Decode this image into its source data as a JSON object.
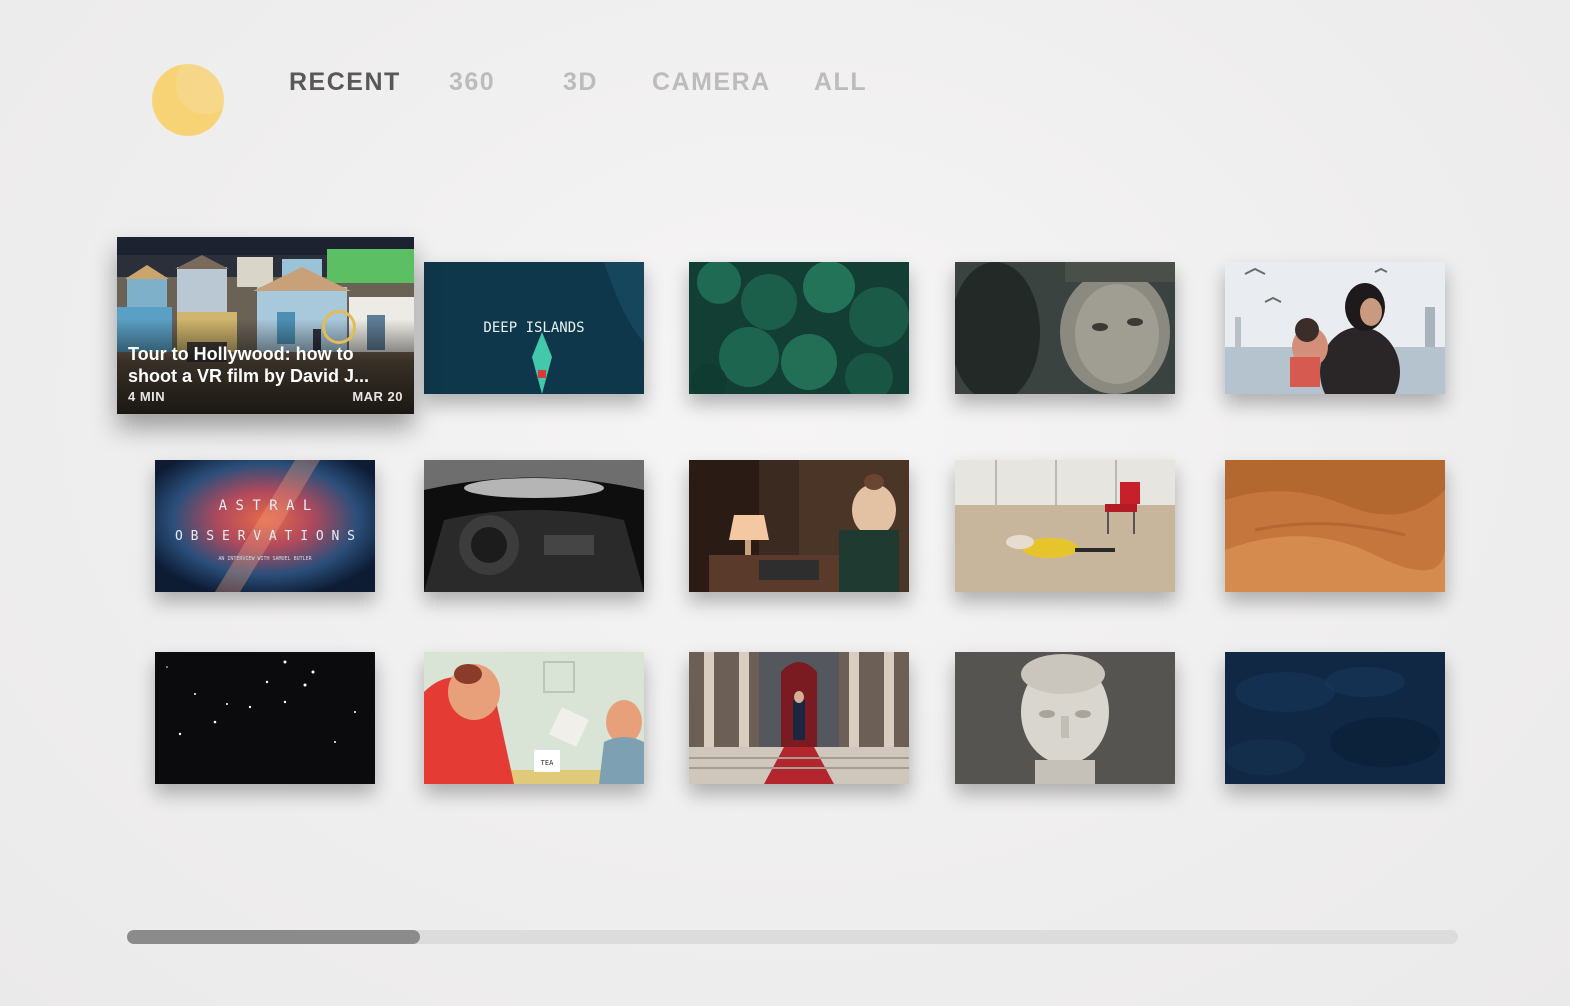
{
  "nav": {
    "items": [
      {
        "label": "RECENT",
        "active": true
      },
      {
        "label": "360",
        "active": false
      },
      {
        "label": "3D",
        "active": false
      },
      {
        "label": "CAMERA",
        "active": false
      },
      {
        "label": "ALL",
        "active": false
      }
    ]
  },
  "logo": {
    "icon": "moon-icon",
    "color": "#f8d376"
  },
  "focused_video": {
    "title": "Tour to Hollywood: how to shoot a VR film by David J...",
    "duration": "4 MIN",
    "date": "MAR 20",
    "gaze_ring_color": "#e2bd54"
  },
  "tiles": [
    {
      "name": "video-tile-hollywood-tour",
      "subject": "colorful film set houses"
    },
    {
      "name": "video-tile-deep-islands",
      "subject": "boat on dark ocean",
      "text": "DEEP ISLANDS"
    },
    {
      "name": "video-tile-forest-aerial",
      "subject": "aerial green forest"
    },
    {
      "name": "video-tile-soldier",
      "subject": "soldier close-up"
    },
    {
      "name": "video-tile-mother-child",
      "subject": "mother and child with seagulls"
    },
    {
      "name": "video-tile-astral-observations",
      "subject": "nebula title card",
      "text_line1": "A S T R A L",
      "text_line2": "O B S E R V A T I O N S",
      "text_line3": "AN INTERVIEW WITH SAMUEL BUTLER"
    },
    {
      "name": "video-tile-car-interior",
      "subject": "black and white car interior"
    },
    {
      "name": "video-tile-desk-lamp",
      "subject": "animated woman at desk with lamp"
    },
    {
      "name": "video-tile-red-chair",
      "subject": "woman lying on floor near red chair"
    },
    {
      "name": "video-tile-desert",
      "subject": "orange desert dunes"
    },
    {
      "name": "video-tile-starfield",
      "subject": "night sky stars"
    },
    {
      "name": "video-tile-cartoon-kitchen",
      "subject": "cartoon characters pouring tea",
      "text": "TEA"
    },
    {
      "name": "video-tile-palace-throne",
      "subject": "man on throne at palace stairs"
    },
    {
      "name": "video-tile-bust-statue",
      "subject": "marble bust statue"
    },
    {
      "name": "video-tile-deep-water",
      "subject": "dark blue water texture"
    }
  ],
  "scrollbar": {
    "position": 0.22
  }
}
